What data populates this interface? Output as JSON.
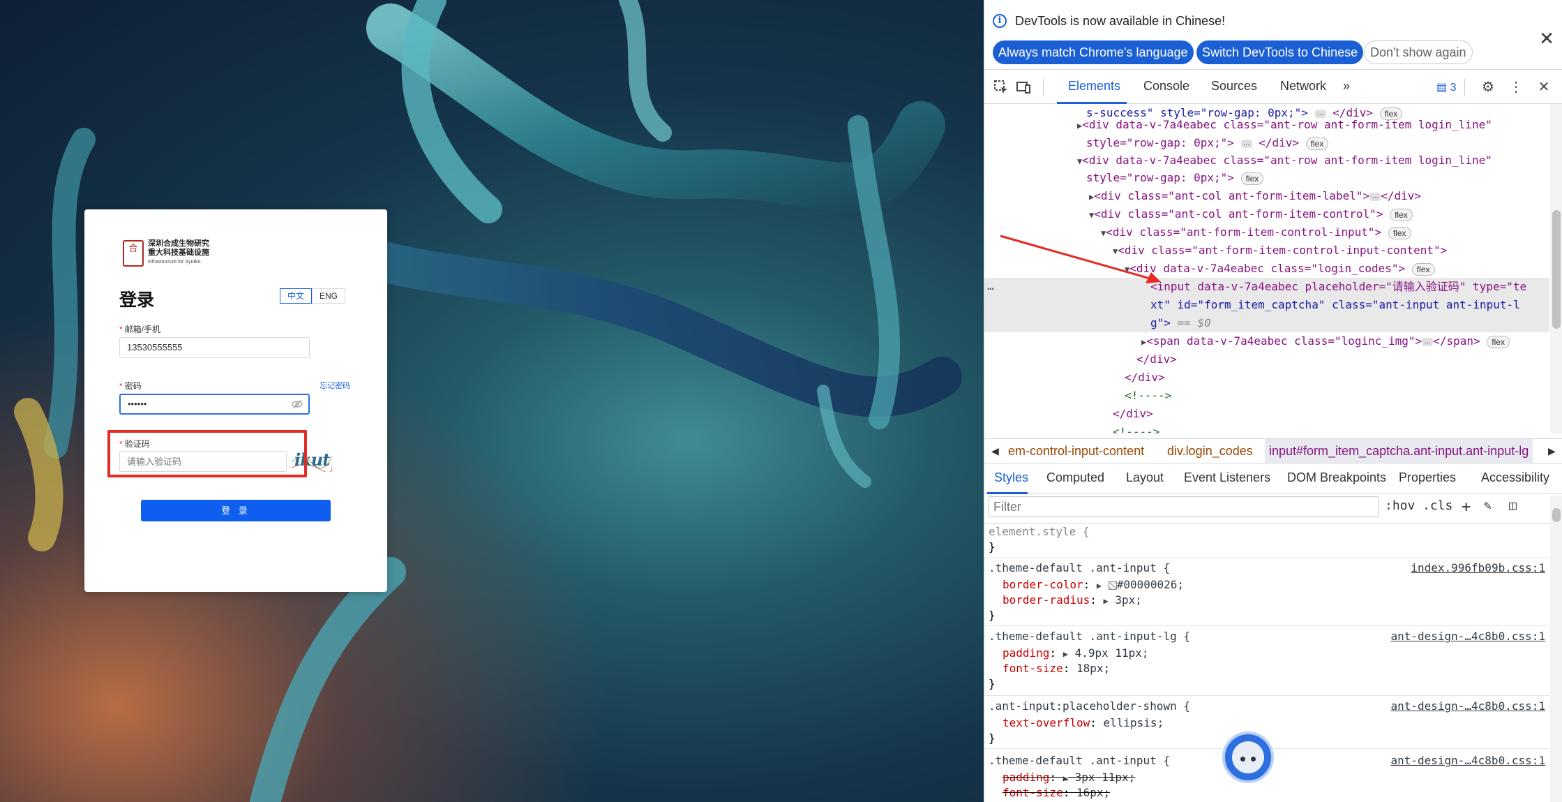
{
  "login": {
    "logo_seal": "合",
    "logo_line1": "深圳合成生物研究",
    "logo_line2": "重大科技基础设施",
    "logo_line3": "Infrastructure for SynBio",
    "title": "登录",
    "lang_zh": "中文",
    "lang_en": "ENG",
    "email_label": "邮箱/手机",
    "email_value": "13530555555",
    "password_label": "密码",
    "forgot_label": "忘记密码",
    "password_value": "••••••",
    "captcha_label": "验证码",
    "captcha_placeholder": "请输入验证码",
    "captcha_text": "ikut",
    "submit_label": "登 录",
    "required_mark": "*"
  },
  "devtools": {
    "info_text": "DevTools is now available in Chinese!",
    "info_btn_match": "Always match Chrome's language",
    "info_btn_switch": "Switch DevTools to Chinese",
    "info_btn_dismiss": "Don't show again",
    "tabs": [
      "Elements",
      "Console",
      "Sources",
      "Network"
    ],
    "issues_count": "3",
    "dom_lines": [
      "s-success\" style=\"row-gap: 0px;\">",
      "<div data-v-7a4eabec class=\"ant-row ant-form-item login_line\"",
      "style=\"row-gap: 0px;\">",
      "<div data-v-7a4eabec class=\"ant-row ant-form-item login_line\"",
      "style=\"row-gap: 0px;\">",
      "<div class=\"ant-col ant-form-item-label\">",
      "<div class=\"ant-col ant-form-item-control\">",
      "<div class=\"ant-form-item-control-input\">",
      "<div class=\"ant-form-item-control-input-content\">",
      "<div data-v-7a4eabec class=\"login_codes\">",
      "<input data-v-7a4eabec placeholder=\"请输入验证码\" type=\"te",
      "xt\" id=\"form_item_captcha\" class=\"ant-input ant-input-l",
      "g\">",
      "<span data-v-7a4eabec class=\"loginc_img\">",
      "</div>",
      "</div>",
      "<!---->",
      "</div>",
      "<!---->"
    ],
    "flex_badge": "flex",
    "selected_marker": "== $0",
    "crumbs": [
      "em-control-input-content",
      "div.login_codes",
      "input#form_item_captcha.ant-input.ant-input-lg"
    ],
    "sub_tabs": [
      "Styles",
      "Computed",
      "Layout",
      "Event Listeners",
      "DOM Breakpoints",
      "Properties",
      "Accessibility"
    ],
    "filter_placeholder": "Filter",
    "hov": ":hov",
    "cls": ".cls",
    "styles": {
      "element_style": "element.style {",
      "rule1_selector": ".theme-default .ant-input {",
      "rule1_source": "index.996fb09b.css:1",
      "rule1_p1": "border-color",
      "rule1_v1": "#00000026;",
      "rule1_p2": "border-radius",
      "rule1_v2": "3px;",
      "rule2_selector": ".theme-default .ant-input-lg {",
      "rule2_source": "ant-design-…4c8b0.css:1",
      "rule2_p1": "padding",
      "rule2_v1": "4.9px 11px;",
      "rule2_p2": "font-size",
      "rule2_v2": "18px;",
      "rule3_selector": ".ant-input:placeholder-shown {",
      "rule3_source": "ant-design-…4c8b0.css:1",
      "rule3_p1": "text-overflow",
      "rule3_v1": "ellipsis;",
      "rule4_selector": ".theme-default .ant-input {",
      "rule4_source": "ant-design-…4c8b0.css:1",
      "rule4_p1": "padding",
      "rule4_v1": "3px 11px;",
      "rule4_p2": "font-size",
      "rule4_v2": "16px;",
      "close": "}"
    }
  },
  "colors": {
    "accent": "#1a5fd3",
    "login_button": "#0e5ff0",
    "highlight": "#e52a22"
  }
}
